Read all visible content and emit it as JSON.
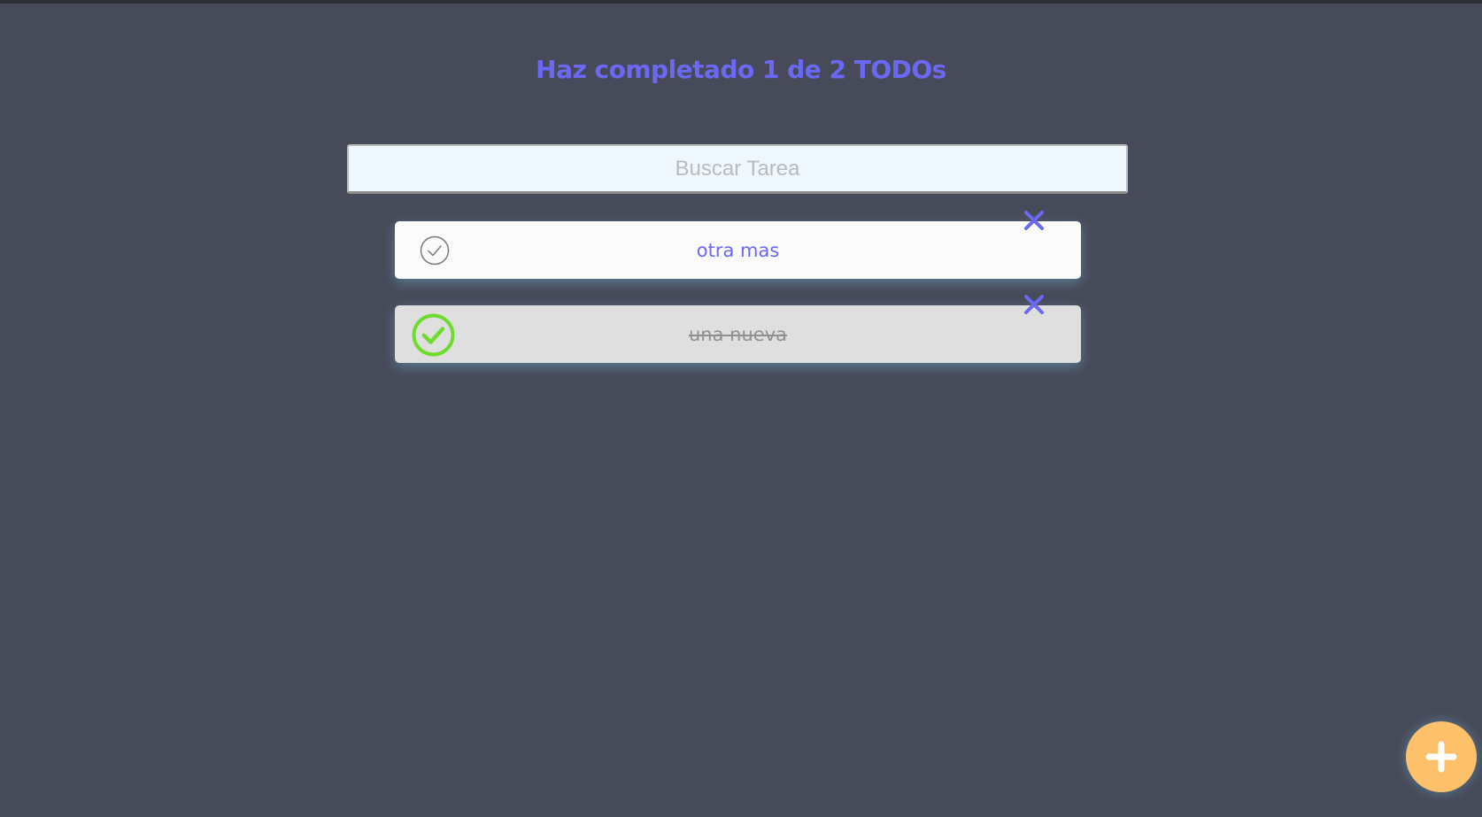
{
  "header": {
    "counter_text": "Haz completado 1 de 2 TODOs"
  },
  "search": {
    "placeholder": "Buscar Tarea",
    "value": ""
  },
  "todos": [
    {
      "text": "otra mas",
      "completed": false,
      "check_icon": "check-circle-outline-icon",
      "delete_icon": "close-icon"
    },
    {
      "text": "una nueva",
      "completed": true,
      "check_icon": "check-circle-filled-icon",
      "delete_icon": "close-icon"
    }
  ],
  "fab": {
    "icon": "plus-icon"
  },
  "colors": {
    "background": "#474a59",
    "accent": "#6b68f5",
    "completed_check": "#6edc2c",
    "fab": "#fcc16a"
  }
}
